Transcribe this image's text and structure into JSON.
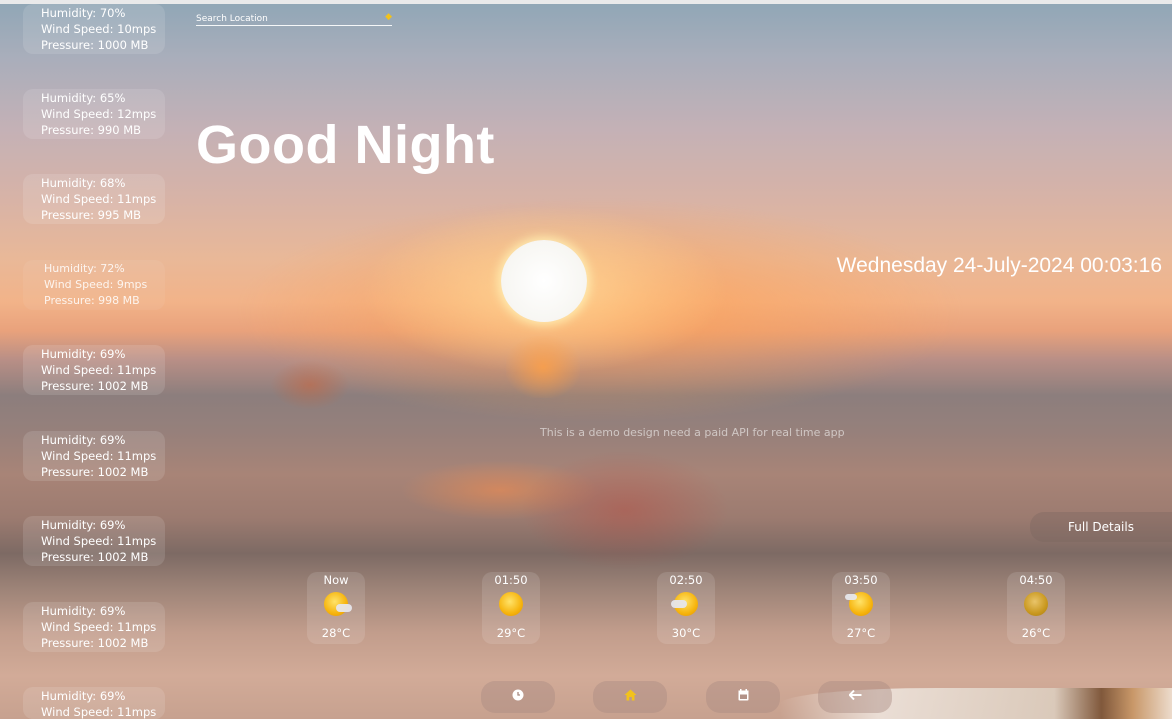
{
  "search": {
    "placeholder": "Search Location"
  },
  "greeting": "Good Night",
  "datetime": "Wednesday 24-July-2024 00:03:16",
  "demo_note": "This is a demo design need a paid API for real time app",
  "full_details_label": "Full Details",
  "info_cards": [
    {
      "humidity": "Humidity: 70%",
      "wind": "Wind Speed: 10mps",
      "pressure": "Pressure: 1000 MB"
    },
    {
      "humidity": "Humidity: 65%",
      "wind": "Wind Speed: 12mps",
      "pressure": "Pressure: 990 MB"
    },
    {
      "humidity": "Humidity: 68%",
      "wind": "Wind Speed: 11mps",
      "pressure": "Pressure: 995 MB"
    },
    {
      "humidity": "Humidity: 72%",
      "wind": "Wind Speed: 9mps",
      "pressure": "Pressure: 998 MB"
    },
    {
      "humidity": "Humidity: 69%",
      "wind": "Wind Speed: 11mps",
      "pressure": "Pressure: 1002 MB"
    },
    {
      "humidity": "Humidity: 69%",
      "wind": "Wind Speed: 11mps",
      "pressure": "Pressure: 1002 MB"
    },
    {
      "humidity": "Humidity: 69%",
      "wind": "Wind Speed: 11mps",
      "pressure": "Pressure: 1002 MB"
    },
    {
      "humidity": "Humidity: 69%",
      "wind": "Wind Speed: 11mps",
      "pressure": "Pressure: 1002 MB"
    },
    {
      "humidity": "Humidity: 69%",
      "wind": "Wind Speed: 11mps",
      "pressure": ""
    }
  ],
  "hourly": [
    {
      "time": "Now",
      "temp": "28°C",
      "icon": "sun-cloud-icon"
    },
    {
      "time": "01:50",
      "temp": "29°C",
      "icon": "sun-icon"
    },
    {
      "time": "02:50",
      "temp": "30°C",
      "icon": "sun-cloud-icon"
    },
    {
      "time": "03:50",
      "temp": "27°C",
      "icon": "sun-cloud-icon"
    },
    {
      "time": "04:50",
      "temp": "26°C",
      "icon": "sun-icon"
    }
  ],
  "nav": [
    {
      "icon": "clock-icon",
      "glyph": "🕓"
    },
    {
      "icon": "home-icon",
      "glyph": "⌂"
    },
    {
      "icon": "calendar-icon",
      "glyph": "▦"
    },
    {
      "icon": "back-arrow-icon",
      "glyph": "←"
    }
  ],
  "colors": {
    "accent": "#f2c21b",
    "text": "#ffffff"
  }
}
